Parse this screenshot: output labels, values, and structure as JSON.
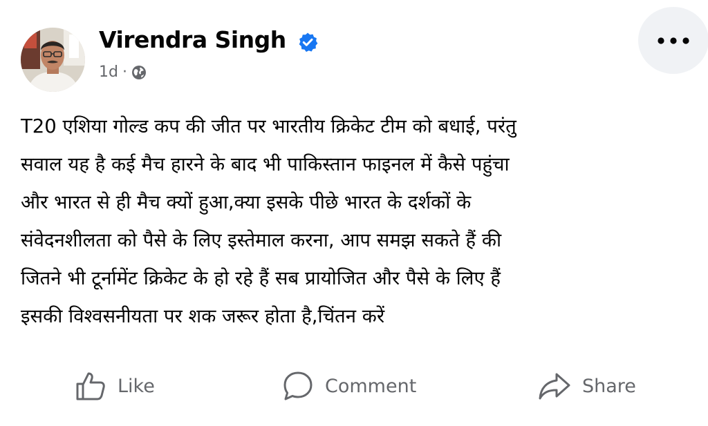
{
  "post": {
    "author": {
      "name": "Virendra Singh",
      "verified": true,
      "avatar_icon": "profile-photo"
    },
    "meta": {
      "time": "1d",
      "separator": "·",
      "audience_icon": "globe-icon"
    },
    "more_icon": "more-horizontal-icon",
    "text_lines": [
      "T20 एशिया गोल्ड कप की जीत पर भारतीय क्रिकेट टीम को बधाई, परंतु",
      "सवाल यह है कई मैच हारने के बाद भी पाकिस्तान फाइनल में कैसे पहुंचा",
      "और भारत से ही मैच क्यों हुआ,क्या इसके पीछे भारत के दर्शकों के",
      "संवेदनशीलता को पैसे के लिए इस्तेमाल करना, आप समझ सकते हैं की",
      "जितने भी टूर्नामेंट क्रिकेट के हो रहे हैं सब प्रायोजित और पैसे के लिए हैं",
      "इसकी विश्वसनीयता पर शक जरूर होता है,चिंतन करें"
    ],
    "actions": {
      "like": {
        "label": "Like",
        "icon": "thumbs-up-icon"
      },
      "comment": {
        "label": "Comment",
        "icon": "comment-bubble-icon"
      },
      "share": {
        "label": "Share",
        "icon": "share-arrow-icon"
      }
    },
    "colors": {
      "text": "#050505",
      "secondary": "#65676b",
      "verified": "#1877f2",
      "more_bg": "#f0f2f5"
    }
  }
}
